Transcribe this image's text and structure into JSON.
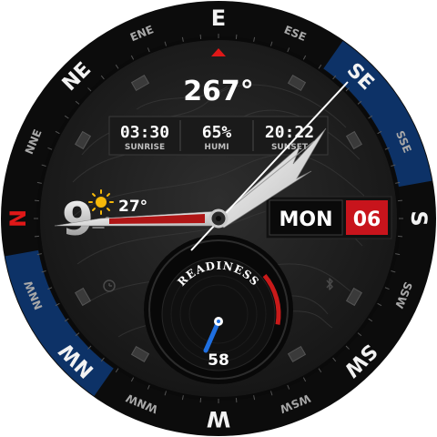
{
  "heading": {
    "value": "267°",
    "pointer_color": "#e01818"
  },
  "bezel": {
    "cardinals": [
      "E",
      "SE",
      "S",
      "SW",
      "W",
      "NW",
      "N",
      "NE"
    ],
    "intercardinals": [
      "ESE",
      "SSE",
      "SSW",
      "WSW",
      "WNW",
      "NNW",
      "NNE",
      "ENE"
    ],
    "north_color": "#e01818",
    "accent_blue": "#0e3a78"
  },
  "info_strip": {
    "sunrise": {
      "value": "03:30",
      "label": "SUNRISE"
    },
    "humidity": {
      "value": "65%",
      "label": "HUMI"
    },
    "sunset": {
      "value": "20:22",
      "label": "SUNSET"
    }
  },
  "hour_marker": "9",
  "weather": {
    "icon": "sun-icon",
    "temperature": "27°",
    "sub_icon": "wind-icon"
  },
  "date": {
    "day": "MON",
    "date": "06",
    "date_bg": "#c8141c"
  },
  "readiness": {
    "label": "READINESS",
    "value": "58",
    "level": 0.58,
    "needle_color": "#1f6fe0",
    "arc_color": "#c81a1a"
  },
  "status_icons": [
    "alarm-icon",
    "bluetooth-icon"
  ],
  "time": {
    "hour": 8,
    "minute": 9
  }
}
